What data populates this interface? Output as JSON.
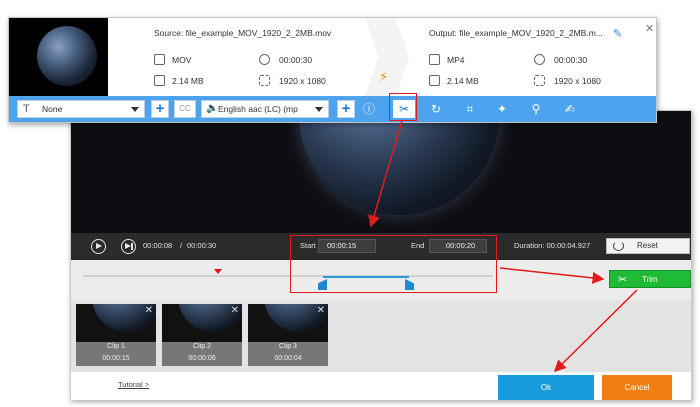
{
  "main_window": {
    "source_title": "Source: file_example_MOV_1920_2_2MB.mov",
    "output_title": "Output: file_example_MOV_1920_2_2MB.m...",
    "source": {
      "format": "MOV",
      "duration": "00:00:30",
      "size": "2.14 MB",
      "resolution": "1920 x 1080"
    },
    "output": {
      "format": "MP4",
      "duration": "00:00:30",
      "size": "2.14 MB",
      "resolution": "1920 x 1080"
    },
    "icons": {
      "edit": "pencil-icon",
      "close": "close-icon",
      "convert": "lightning-icon"
    },
    "toolbar": {
      "subtitle_select": "None",
      "add_subtitle": "+",
      "cc": "CC",
      "audio_select": "English aac (LC) (mp",
      "add_audio": "+",
      "tools": [
        "info-icon",
        "scissors-icon",
        "rotate-icon",
        "crop-icon",
        "effects-icon",
        "watermark-icon",
        "subtitle-edit-icon"
      ]
    }
  },
  "trim_window": {
    "controls": {
      "current_time": "00:00:08",
      "separator": "/",
      "total_time": "00:00:30",
      "start_label": "Start",
      "start_value": "00:00:15",
      "end_label": "End",
      "end_value": "00:00:20",
      "duration_text": "Duration: 00:00:04.927",
      "reset_label": "Reset"
    },
    "timeline": {
      "playhead_fraction": 0.27,
      "selection_start_fraction": 0.5,
      "selection_end_fraction": 0.667
    },
    "trim_label": "Trim",
    "clips": [
      {
        "name": "Clip 1",
        "duration": "00:00:15"
      },
      {
        "name": "Clip 2",
        "duration": "00:00:06"
      },
      {
        "name": "Clip 3",
        "duration": "00:00:04"
      }
    ],
    "tutorial_link": "Tutorial >",
    "ok_label": "Ok",
    "cancel_label": "Cancel"
  },
  "colors": {
    "toolbar": "#4da3ee",
    "trim_button": "#1fbb35",
    "ok_button": "#1a9bdc",
    "cancel_button": "#f27f14",
    "annotation": "#e31b1b"
  }
}
